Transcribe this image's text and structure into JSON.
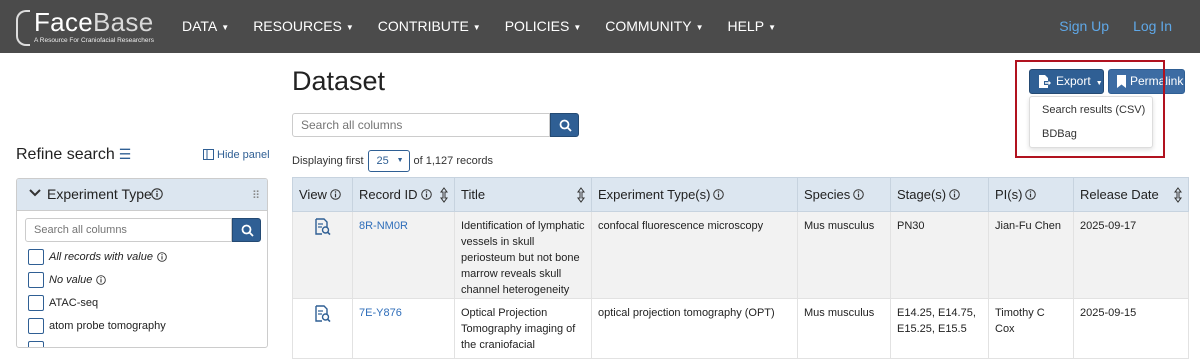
{
  "brand": {
    "name_a": "Face",
    "name_b": "Base",
    "tagline": "A Resource For Craniofacial Researchers"
  },
  "nav": {
    "items": [
      "DATA",
      "RESOURCES",
      "CONTRIBUTE",
      "POLICIES",
      "COMMUNITY",
      "HELP"
    ],
    "signup": "Sign Up",
    "login": "Log In"
  },
  "page": {
    "title": "Dataset"
  },
  "search": {
    "placeholder": "Search all columns"
  },
  "pagination": {
    "prefix": "Displaying first",
    "page_size": "25",
    "suffix": "of 1,127 records"
  },
  "export": {
    "label": "Export",
    "menu": [
      "Search results (CSV)",
      "BDBag"
    ]
  },
  "permalink": {
    "label": "Permalink"
  },
  "sidebar": {
    "title": "Refine search",
    "hide_panel": "Hide panel",
    "facet": {
      "title": "Experiment Type",
      "search_placeholder": "Search all columns",
      "options": [
        "All records with value",
        "No value",
        "ATAC-seq",
        "atom probe tomography"
      ]
    }
  },
  "table": {
    "headers": [
      "View",
      "Record ID",
      "Title",
      "Experiment Type(s)",
      "Species",
      "Stage(s)",
      "PI(s)",
      "Release Date"
    ],
    "rows": [
      {
        "record_id": "8R-NM0R",
        "title": "Identification of lymphatic vessels in skull periosteum but not bone marrow reveals skull channel heterogeneity",
        "experiment_types": "confocal fluorescence microscopy",
        "species": "Mus musculus",
        "stages": "PN30",
        "pis": "Jian-Fu Chen",
        "release_date": "2025-09-17"
      },
      {
        "record_id": "7E-Y876",
        "title": "Optical Projection Tomography imaging of the craniofacial",
        "experiment_types": "optical projection tomography (OPT)",
        "species": "Mus musculus",
        "stages": "E14.25, E14.75, E15.25, E15.5",
        "pis": "Timothy C Cox",
        "release_date": "2025-09-15"
      }
    ]
  },
  "colors": {
    "navbar": "#4b4b4b",
    "primary": "#2f5f94",
    "link": "#2f6eba",
    "header_bg": "#dce6f0",
    "highlight": "#b1121f"
  }
}
